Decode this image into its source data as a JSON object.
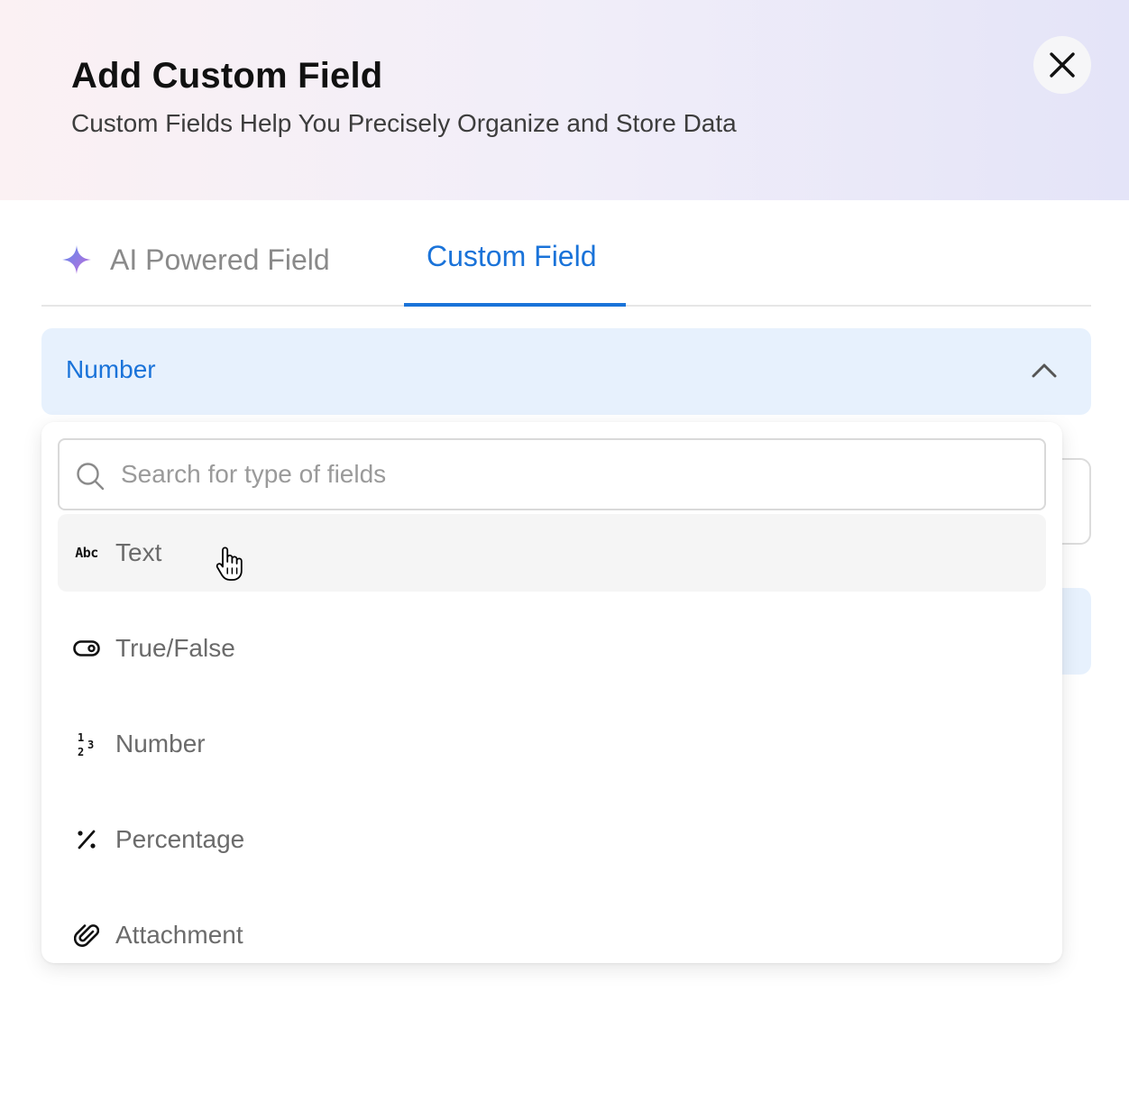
{
  "dialog": {
    "title": "Add Custom Field",
    "subtitle": "Custom Fields Help You Precisely Organize and Store Data",
    "close_icon": "close-icon"
  },
  "tabs": {
    "ai_label": "AI Powered Field",
    "ai_icon": "sparkle-icon",
    "custom_label": "Custom Field",
    "active": "Custom Field"
  },
  "field_type_select": {
    "selected": "Number",
    "state": "expanded"
  },
  "dropdown": {
    "search_placeholder": "Search for type of fields",
    "options": [
      {
        "label": "Text",
        "icon": "abc-text-icon",
        "hovered": true
      },
      {
        "label": "True/False",
        "icon": "toggle-icon"
      },
      {
        "label": "Number",
        "icon": "number-icon"
      },
      {
        "label": "Percentage",
        "icon": "percent-icon"
      },
      {
        "label": "Attachment",
        "icon": "paperclip-icon"
      }
    ]
  },
  "colors": {
    "accent": "#1a73d9",
    "select_bg": "#e7f1fd",
    "hover_bg": "#f5f5f5"
  }
}
